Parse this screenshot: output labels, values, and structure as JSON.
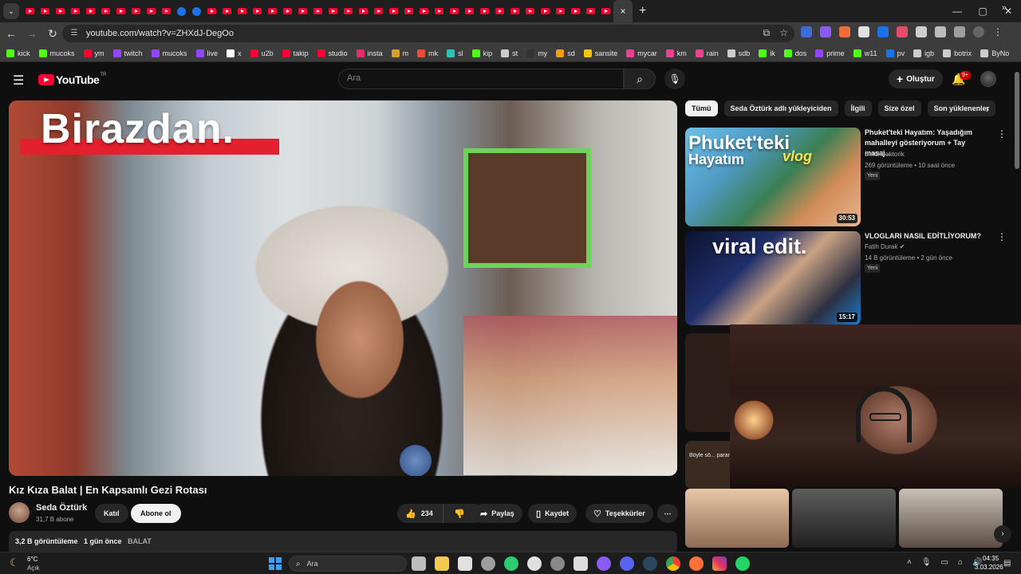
{
  "browser": {
    "tab_menu_icon": "chevron-down-icon",
    "tab_close": "×",
    "new_tab": "+",
    "window_controls": [
      "—",
      "▢",
      "✕"
    ],
    "url": "youtube.com/watch?v=ZHXdJ-DegOo",
    "bookmarks": [
      {
        "label": "kick",
        "color": "#53fc18"
      },
      {
        "label": "mucoks",
        "color": "#53fc18"
      },
      {
        "label": "ym",
        "color": "#ff0033"
      },
      {
        "label": "twitch",
        "color": "#9146ff"
      },
      {
        "label": "mucoks",
        "color": "#9146ff"
      },
      {
        "label": "live",
        "color": "#9146ff"
      },
      {
        "label": "x",
        "color": "#ffffff"
      },
      {
        "label": "u2b",
        "color": "#ff0033"
      },
      {
        "label": "takip",
        "color": "#ff0033"
      },
      {
        "label": "studio",
        "color": "#ff0033"
      },
      {
        "label": "insta",
        "color": "#e1306c"
      },
      {
        "label": "m",
        "color": "#d4a030"
      },
      {
        "label": "mk",
        "color": "#e74c3c"
      },
      {
        "label": "sl",
        "color": "#2ec4b6"
      },
      {
        "label": "kip",
        "color": "#53fc18"
      },
      {
        "label": "st",
        "color": "#cccccc"
      },
      {
        "label": "my",
        "color": "#333333"
      },
      {
        "label": "sd",
        "color": "#f39c12"
      },
      {
        "label": "sansite",
        "color": "#f1c40f"
      },
      {
        "label": "mycar",
        "color": "#e84393"
      },
      {
        "label": "km",
        "color": "#e84393"
      },
      {
        "label": "rain",
        "color": "#e84393"
      },
      {
        "label": "sdb",
        "color": "#cccccc"
      },
      {
        "label": "ik",
        "color": "#53fc18"
      },
      {
        "label": "dos",
        "color": "#53fc18"
      },
      {
        "label": "prime",
        "color": "#9146ff"
      },
      {
        "label": "w11",
        "color": "#53fc18"
      },
      {
        "label": "pv",
        "color": "#1a73e8"
      },
      {
        "label": "igb",
        "color": "#cccccc"
      },
      {
        "label": "botrix",
        "color": "#cccccc"
      },
      {
        "label": "ByNo",
        "color": "#cccccc"
      }
    ],
    "bookmarks_more": "»"
  },
  "header": {
    "logo_text": "YouTube",
    "logo_region": "TR",
    "search_placeholder": "Ara",
    "create_label": "Oluştur",
    "notification_count": "9+"
  },
  "video": {
    "overlay_text": "Birazdan.",
    "title": "Kız Kıza Balat | En Kapsamlı Gezi Rotası",
    "channel": "Seda Öztürk",
    "subscribers": "31,7 B abone",
    "join_label": "Katıl",
    "subscribe_label": "Abone ol",
    "likes": "234",
    "share_label": "Paylaş",
    "save_label": "Kaydet",
    "thanks_label": "Teşekkürler",
    "views": "3,2 B görüntüleme",
    "published": "1 gün önce",
    "tag": "BALAT"
  },
  "chips": [
    "Tümü",
    "Seda Öztürk adlı yükleyiciden",
    "İlgili",
    "Size özel",
    "Son yüklenenler"
  ],
  "recommendations": [
    {
      "title": "Phuket'teki Hayatım: Yaşadığım mahalleyi gösteriyorum + Tay masaj...",
      "channel": "Betül Sohtorik",
      "meta": "269 görüntüleme • 10 saat önce",
      "badge": "Yeni",
      "duration": "30:53",
      "thumb_line1": "Phuket'teki",
      "thumb_line2": "Hayatım",
      "thumb_line3": "vlog"
    },
    {
      "title": "VLOGLARI NASIL EDİTLİYORUM?",
      "channel": "Fatih Durak",
      "meta": "14 B görüntüleme • 2 gün önce",
      "badge": "Yeni",
      "duration": "15:17",
      "thumb_line1": "viral edit."
    }
  ],
  "partial_thumb_text": "Böyle sö... paran...",
  "taskbar": {
    "temperature": "6°C",
    "weather": "Açık",
    "search_placeholder": "Ara",
    "time": "04:35",
    "date": "3.03.2026"
  }
}
